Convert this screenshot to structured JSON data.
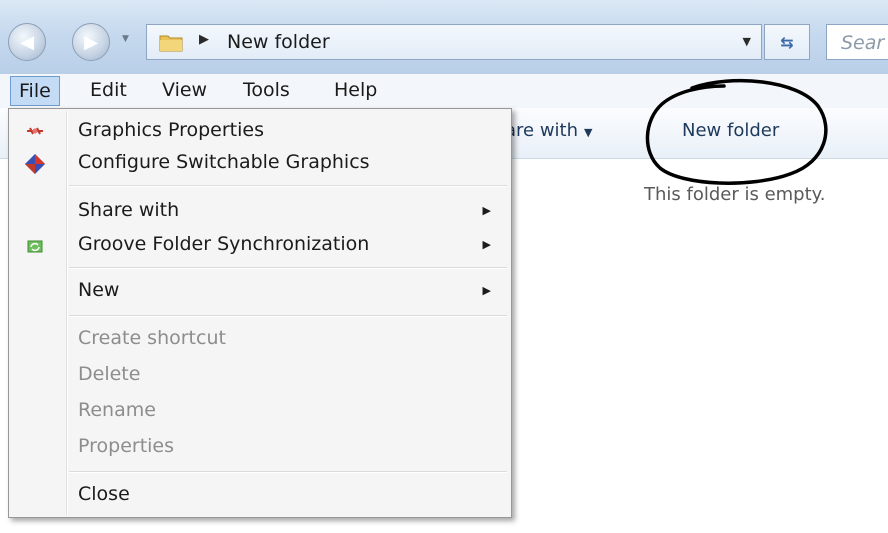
{
  "address_bar": {
    "path": "New folder",
    "search_placeholder": "Sear",
    "back_icon": "back-arrow-icon",
    "forward_icon": "forward-arrow-icon",
    "refresh_icon": "refresh-icon"
  },
  "menubar": {
    "items": [
      {
        "label": "File",
        "active": true
      },
      {
        "label": "Edit",
        "active": false
      },
      {
        "label": "View",
        "active": false
      },
      {
        "label": "Tools",
        "active": false
      },
      {
        "label": "Help",
        "active": false
      }
    ]
  },
  "toolbar": {
    "share_label": "are with",
    "new_folder_label": "New folder"
  },
  "content": {
    "empty_message": "This folder is empty."
  },
  "file_menu": {
    "items": [
      {
        "label": "Graphics Properties",
        "icon": "graphics-properties-icon"
      },
      {
        "label": "Configure Switchable Graphics",
        "icon": "switchable-graphics-icon"
      },
      {
        "label": "Share with",
        "submenu": true
      },
      {
        "label": "Groove Folder Synchronization",
        "icon": "groove-sync-icon",
        "submenu": true
      },
      {
        "label": "New",
        "submenu": true
      },
      {
        "label": "Create shortcut",
        "disabled": true
      },
      {
        "label": "Delete",
        "disabled": true
      },
      {
        "label": "Rename",
        "disabled": true
      },
      {
        "label": "Properties",
        "disabled": true
      },
      {
        "label": "Close"
      }
    ]
  },
  "annotation": {
    "color": "#000000",
    "target": "New folder"
  }
}
